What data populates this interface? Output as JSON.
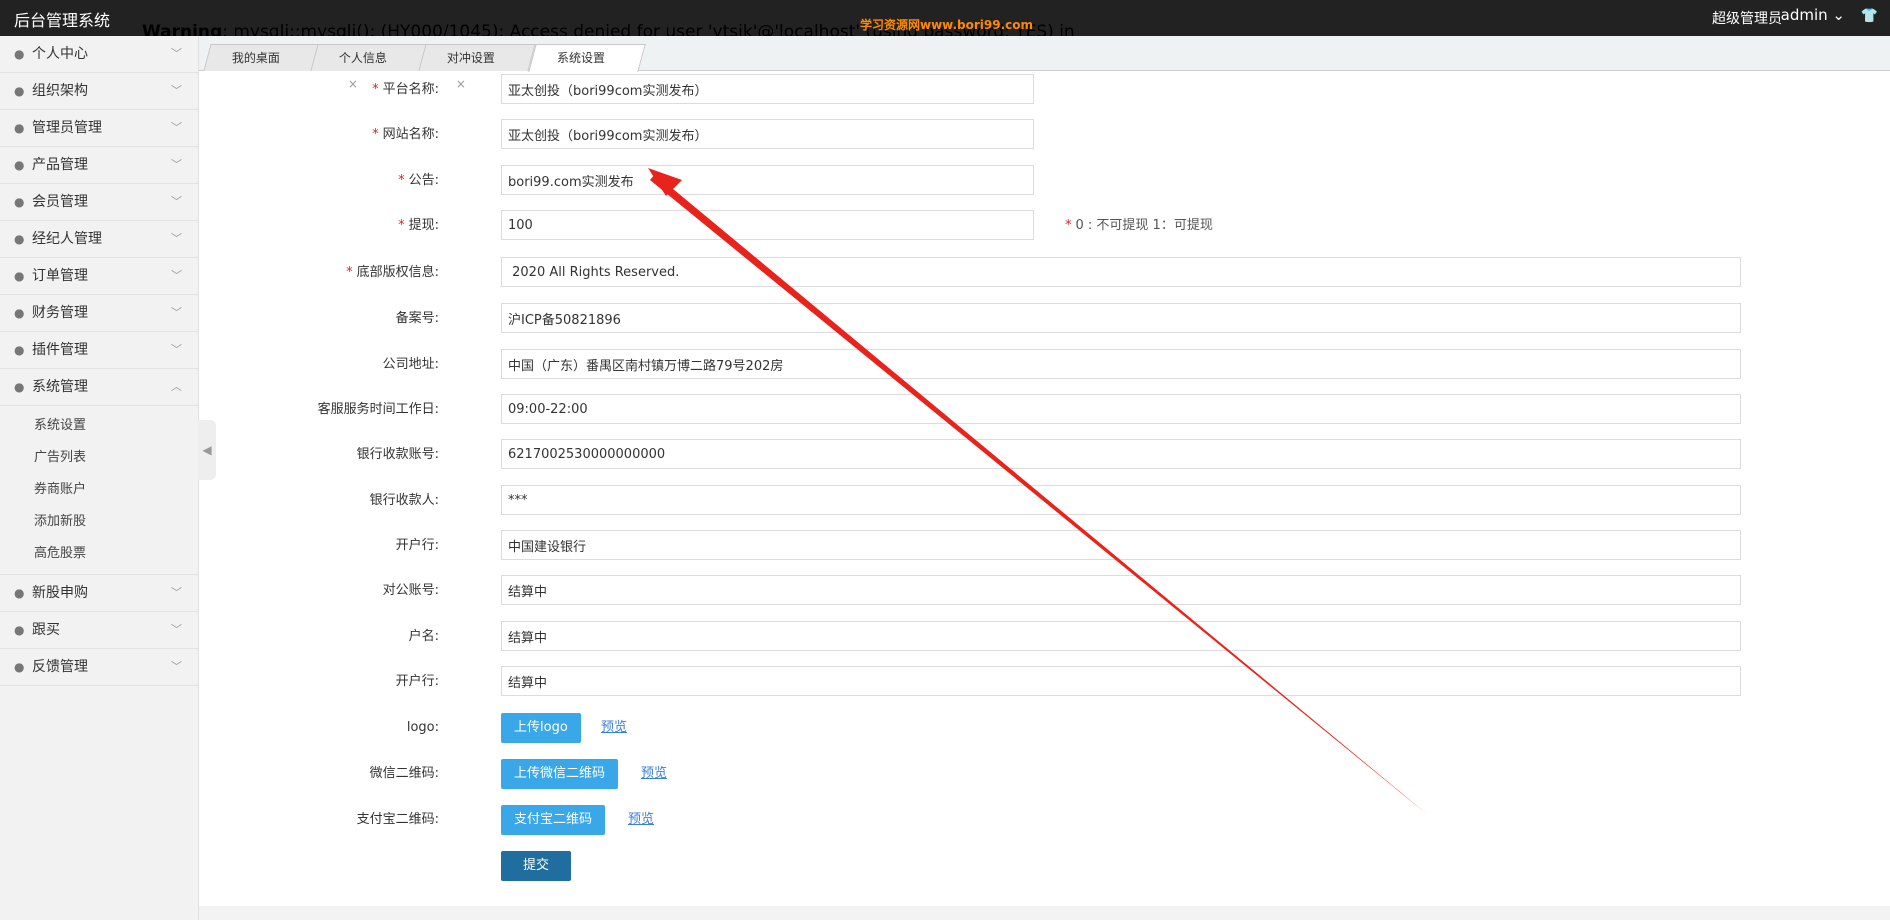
{
  "header": {
    "app_title": "后台管理系统",
    "warning_label": "Warning",
    "warning_text": ": mysqli::mysqli(): (HY000/1045): Access denied for user 'ytsjk'@'localhost' (using password: YES) in",
    "watermark": "学习资源网www.bori99.com",
    "role": "超级管理员",
    "username": "admin",
    "user_dropdown_icon": "chevron-down-icon",
    "shirt_icon": "shirt-icon"
  },
  "sidebar": {
    "items": [
      {
        "label": "个人中心",
        "icon": "user-icon"
      },
      {
        "label": "组织架构",
        "icon": "org-icon"
      },
      {
        "label": "管理员管理",
        "icon": "admin-icon"
      },
      {
        "label": "产品管理",
        "icon": "bag-icon"
      },
      {
        "label": "会员管理",
        "icon": "member-icon"
      },
      {
        "label": "经纪人管理",
        "icon": "broker-icon"
      },
      {
        "label": "订单管理",
        "icon": "order-icon"
      },
      {
        "label": "财务管理",
        "icon": "finance-icon"
      },
      {
        "label": "插件管理",
        "icon": "plugin-icon"
      },
      {
        "label": "系统管理",
        "icon": "gear-icon",
        "expanded": true
      }
    ],
    "sub_items": [
      "系统设置",
      "广告列表",
      "券商账户",
      "添加新股",
      "高危股票"
    ],
    "items_after": [
      {
        "label": "新股申购",
        "icon": "ipo-icon"
      },
      {
        "label": "跟买",
        "icon": "follow-icon"
      },
      {
        "label": "反馈管理",
        "icon": "feedback-icon"
      }
    ]
  },
  "tabs": [
    {
      "label": "我的桌面",
      "closable": false
    },
    {
      "label": "个人信息",
      "closable": true
    },
    {
      "label": "对冲设置",
      "closable": true
    },
    {
      "label": "系统设置",
      "closable": true,
      "active": true
    }
  ],
  "tab_close_glyph": "×",
  "form": {
    "fields": [
      {
        "label": "平台名称:",
        "required": true,
        "value": "亚太创投（bori99com实测发布）",
        "size": "short"
      },
      {
        "label": "网站名称:",
        "required": true,
        "value": "亚太创投（bori99com实测发布）",
        "size": "short"
      },
      {
        "label": "公告:",
        "required": true,
        "value": "bori99.com实测发布",
        "size": "short"
      },
      {
        "label": "提现:",
        "required": true,
        "value": "100",
        "size": "short",
        "hint": "0 : 不可提现 1：可提现"
      },
      {
        "label": "底部版权信息:",
        "required": true,
        "value": " 2020 All Rights Reserved.",
        "size": "long"
      },
      {
        "label": "备案号:",
        "required": false,
        "value": "沪ICP备50821896",
        "size": "long"
      },
      {
        "label": "公司地址:",
        "required": false,
        "value": "中国（广东）番禺区南村镇万博二路79号202房",
        "size": "long"
      },
      {
        "label": "客服服务时间工作日:",
        "required": false,
        "value": "09:00-22:00",
        "size": "long"
      },
      {
        "label": "银行收款账号:",
        "required": false,
        "value": "6217002530000000000",
        "size": "long"
      },
      {
        "label": "银行收款人:",
        "required": false,
        "value": "***",
        "size": "long"
      },
      {
        "label": "开户行:",
        "required": false,
        "value": "中国建设银行",
        "size": "long"
      },
      {
        "label": "对公账号:",
        "required": false,
        "value": "结算中",
        "size": "long"
      },
      {
        "label": "户名:",
        "required": false,
        "value": "结算中",
        "size": "long"
      },
      {
        "label": "开户行:",
        "required": false,
        "value": "结算中",
        "size": "long"
      }
    ],
    "uploads": [
      {
        "label": "logo:",
        "button": "上传logo",
        "preview": "预览"
      },
      {
        "label": "微信二维码:",
        "button": "上传微信二维码",
        "preview": "预览"
      },
      {
        "label": "支付宝二维码:",
        "button": "支付宝二维码",
        "preview": "预览"
      }
    ],
    "submit_label": "提交",
    "required_mark": "*"
  },
  "colors": {
    "topbar": "#222222",
    "sidebar_bg": "#f2f2f2",
    "upload_button": "#3aa8e8",
    "submit_button": "#1f6e9f",
    "required": "#e02020",
    "annotation_arrow": "#e8231b"
  }
}
